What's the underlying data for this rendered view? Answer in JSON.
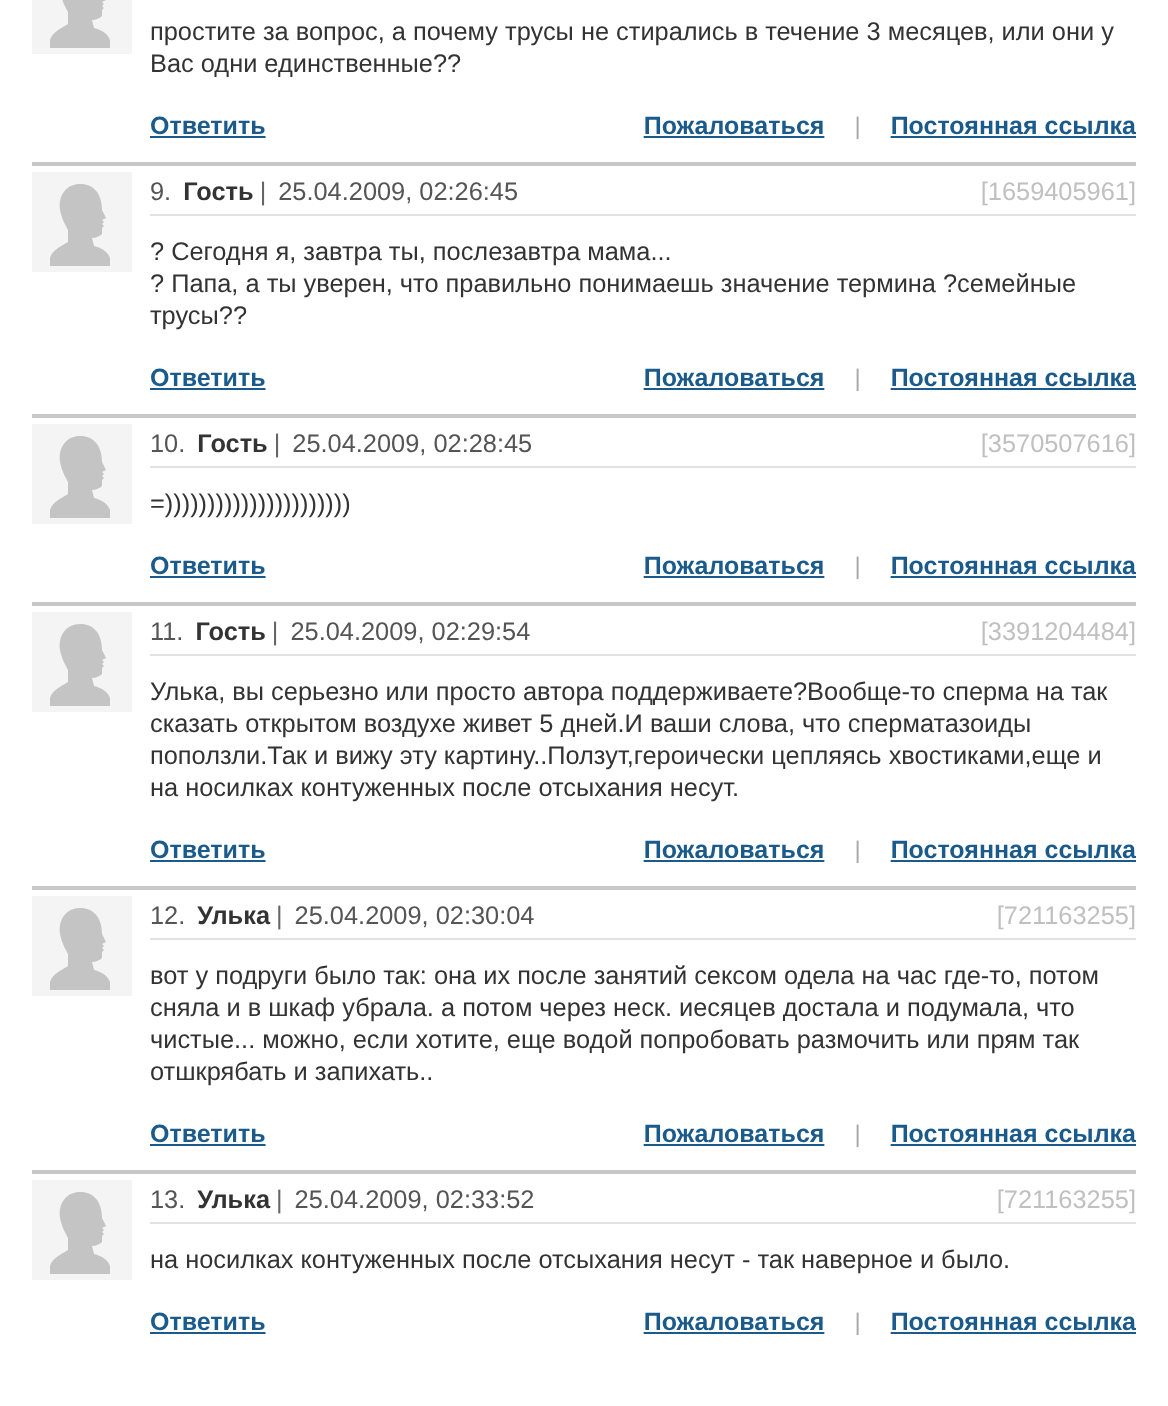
{
  "comments": [
    {
      "kind": "cut",
      "paragraphs": [
        "простите за вопрос, а почему трусы не стирались в течение 3 месяцев, или они у Вас одни единственные??"
      ],
      "actions": {
        "reply": "Ответить",
        "report": "Пожаловаться",
        "separator": "|",
        "permalink": "Постоянная ссылка"
      }
    },
    {
      "kind": "full",
      "number": "9.",
      "author": "Гость",
      "divider": "|",
      "date": "25.04.2009, 02:26:45",
      "code": "[1659405961]",
      "paragraphs": [
        "? Сегодня я, завтра ты, послезавтра мама...",
        "? Папа, а ты уверен, что правильно понимаешь значение термина ?семейные трусы??"
      ],
      "actions": {
        "reply": "Ответить",
        "report": "Пожаловаться",
        "separator": "|",
        "permalink": "Постоянная ссылка"
      }
    },
    {
      "kind": "full",
      "number": "10.",
      "author": "Гость",
      "divider": "|",
      "date": "25.04.2009, 02:28:45",
      "code": "[3570507616]",
      "paragraphs": [
        "=))))))))))))))))))))))"
      ],
      "actions": {
        "reply": "Ответить",
        "report": "Пожаловаться",
        "separator": "|",
        "permalink": "Постоянная ссылка"
      }
    },
    {
      "kind": "full",
      "number": "11.",
      "author": "Гость",
      "divider": "|",
      "date": "25.04.2009, 02:29:54",
      "code": "[3391204484]",
      "paragraphs": [
        "Улька, вы серьезно или просто автора поддерживаете?Вообще-то сперма на так сказать открытом воздухе живет 5 дней.И ваши слова, что сперматазоиды поползли.Так и вижу эту картину..Ползут,героически цепляясь хвостиками,еще и на носилках контуженных после отсыхания несут."
      ],
      "actions": {
        "reply": "Ответить",
        "report": "Пожаловаться",
        "separator": "|",
        "permalink": "Постоянная ссылка"
      }
    },
    {
      "kind": "full",
      "number": "12.",
      "author": "Улька",
      "divider": "|",
      "date": "25.04.2009, 02:30:04",
      "code": "[721163255]",
      "paragraphs": [
        "вот у подруги было так: она их после занятий сексом одела на час где-то, потом сняла и в шкаф убрала. а потом через неск. иесяцев достала и подумала, что чистые... можно, если хотите, еще водой попробовать размочить или прям так отшкрябать и запихать.."
      ],
      "actions": {
        "reply": "Ответить",
        "report": "Пожаловаться",
        "separator": "|",
        "permalink": "Постоянная ссылка"
      }
    },
    {
      "kind": "full",
      "number": "13.",
      "author": "Улька",
      "divider": "|",
      "date": "25.04.2009, 02:33:52",
      "code": "[721163255]",
      "paragraphs": [
        "на носилках контуженных после отсыхания несут - так наверное и было."
      ],
      "actions": {
        "reply": "Ответить",
        "report": "Пожаловаться",
        "separator": "|",
        "permalink": "Постоянная ссылка"
      }
    }
  ]
}
